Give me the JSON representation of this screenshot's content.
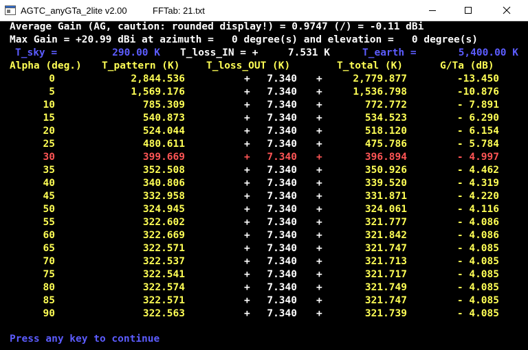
{
  "window": {
    "app_title": "AGTC_anyGTa_2lite v2.00",
    "doc_title": "FFTab: 21.txt"
  },
  "summary": {
    "avg_gain_line": "Average Gain (AG, caution: rounded display!) = 0.9747 (/) = -0.11 dBi",
    "max_gain_line": "Max Gain = +20.99 dBi at azimuth =   0 degree(s) and elevation =   0 degree(s)"
  },
  "temps": {
    "sky_label": "T_sky =",
    "sky_value": "290.00 K",
    "loss_in_label": "T_loss_IN = +",
    "loss_in_value": "7.531 K",
    "earth_label": "T_earth =",
    "earth_value": "5,400.00 K"
  },
  "table": {
    "headers": [
      "Alpha (deg.)",
      "T_pattern (K)",
      "T_loss_OUT (K)",
      "T_total (K)",
      "G/Ta (dB)"
    ],
    "highlight_row": 6,
    "rows": [
      {
        "alpha": "0",
        "pattern": "2,844.536",
        "loss": "7.340",
        "total": "2,779.877",
        "gta": "-13.450"
      },
      {
        "alpha": "5",
        "pattern": "1,569.176",
        "loss": "7.340",
        "total": "1,536.798",
        "gta": "-10.876"
      },
      {
        "alpha": "10",
        "pattern": "785.309",
        "loss": "7.340",
        "total": "772.772",
        "gta": "- 7.891"
      },
      {
        "alpha": "15",
        "pattern": "540.873",
        "loss": "7.340",
        "total": "534.523",
        "gta": "- 6.290"
      },
      {
        "alpha": "20",
        "pattern": "524.044",
        "loss": "7.340",
        "total": "518.120",
        "gta": "- 6.154"
      },
      {
        "alpha": "25",
        "pattern": "480.611",
        "loss": "7.340",
        "total": "475.786",
        "gta": "- 5.784"
      },
      {
        "alpha": "30",
        "pattern": "399.669",
        "loss": "7.340",
        "total": "396.894",
        "gta": "- 4.997"
      },
      {
        "alpha": "35",
        "pattern": "352.508",
        "loss": "7.340",
        "total": "350.926",
        "gta": "- 4.462"
      },
      {
        "alpha": "40",
        "pattern": "340.806",
        "loss": "7.340",
        "total": "339.520",
        "gta": "- 4.319"
      },
      {
        "alpha": "45",
        "pattern": "332.958",
        "loss": "7.340",
        "total": "331.871",
        "gta": "- 4.220"
      },
      {
        "alpha": "50",
        "pattern": "324.945",
        "loss": "7.340",
        "total": "324.061",
        "gta": "- 4.116"
      },
      {
        "alpha": "55",
        "pattern": "322.602",
        "loss": "7.340",
        "total": "321.777",
        "gta": "- 4.086"
      },
      {
        "alpha": "60",
        "pattern": "322.669",
        "loss": "7.340",
        "total": "321.842",
        "gta": "- 4.086"
      },
      {
        "alpha": "65",
        "pattern": "322.571",
        "loss": "7.340",
        "total": "321.747",
        "gta": "- 4.085"
      },
      {
        "alpha": "70",
        "pattern": "322.537",
        "loss": "7.340",
        "total": "321.713",
        "gta": "- 4.085"
      },
      {
        "alpha": "75",
        "pattern": "322.541",
        "loss": "7.340",
        "total": "321.717",
        "gta": "- 4.085"
      },
      {
        "alpha": "80",
        "pattern": "322.574",
        "loss": "7.340",
        "total": "321.749",
        "gta": "- 4.085"
      },
      {
        "alpha": "85",
        "pattern": "322.571",
        "loss": "7.340",
        "total": "321.747",
        "gta": "- 4.085"
      },
      {
        "alpha": "90",
        "pattern": "322.563",
        "loss": "7.340",
        "total": "321.739",
        "gta": "- 4.085"
      }
    ]
  },
  "plus_sign": "+",
  "prompt": "Press any key to continue",
  "colors": {
    "background": "#000000",
    "text_white": "#ffffff",
    "text_yellow": "#ffff55",
    "text_blue": "#5c5cff",
    "highlight_red": "#ff5555"
  }
}
